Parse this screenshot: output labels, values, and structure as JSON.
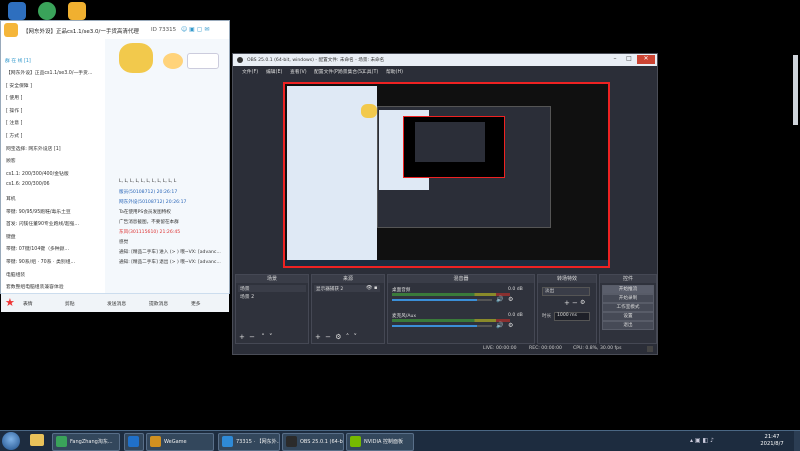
{
  "chat": {
    "title": "【网东外设】正品cs1.1/se3.0/一手货高清代理",
    "id": "ID 73315",
    "side_tab": "群 在 线 [1]",
    "side_rows": [
      "【网东外设】正品cs1.1/se3.0/一手货...",
      "[ 安全保障 ]",
      "[ 使用 ]",
      "[ 操作 ]",
      "[ 注意 ]",
      "[ 方式 ]",
      "网宝选择: 网东外设店 [1]",
      "顾客",
      "cs1.1: 200/300/400/金钻版",
      "cs1.6: 200/300/06",
      "耳机",
      "带键: 90/95/95跑鞋/毒乐土豆",
      "首发: 闪镁任董90专业跑线/超强...",
      "键盘",
      "带键: 07键/104键（多种颜...",
      "带键: 90系/组 · 70系 · 类别组...",
      "电脑组装",
      "套数整组电脑组装兼容体验"
    ],
    "messages": [
      "L, L, L, L, L, L, L, L, L, L, L",
      "版员(50108712) 20:26:17",
      "网东外设(50108712) 20:26:17",
      "Ta在使用PS会员发图特权",
      "广告消息截图，不要留在本群",
      "东风(301115610) 21:26:45",
      "感觉",
      "通知: [精品二手车] 进入 (> ) 哦~VX: [advanc...",
      "通知: [精品二手车] 退出 (> ) 哦~VX: [advanc..."
    ],
    "toolbar": [
      "表情",
      "剪贴",
      "发送消息",
      "提款消息",
      "更多"
    ]
  },
  "obs": {
    "title": "OBS 25.0.1 (64-bit, windows) - 配置文件: 未命名 - 场景: 未命名",
    "menu": [
      "文件(F)",
      "编辑(E)",
      "查看(V)",
      "配置文件(P)",
      "场景集合(S)",
      "工具(T)",
      "帮助(H)"
    ],
    "docks": {
      "scenes": {
        "header": "场景",
        "items": [
          "场景",
          "场景 2"
        ]
      },
      "sources": {
        "header": "来源",
        "items": [
          "显示器捕获 2"
        ]
      },
      "mixer": {
        "header": "混音器",
        "channels": [
          {
            "name": "桌面音频",
            "level": "0.0 dB",
            "volume": 0.85
          },
          {
            "name": "麦克风/Aux",
            "level": "0.0 dB",
            "volume": 0.85
          }
        ]
      },
      "transitions": {
        "header": "转场特效",
        "type": "淡出",
        "duration_label": "时长",
        "duration": "1000 ms"
      },
      "controls": {
        "header": "控件",
        "buttons": [
          "开始推流",
          "开始录制",
          "工作室模式",
          "设置",
          "退出"
        ]
      }
    },
    "status": {
      "live": "LIVE: 00:00:00",
      "rec": "REC: 00:00:00",
      "cpu": "CPU: 0.8%, 30.00 fps"
    }
  },
  "taskbar": {
    "items": [
      {
        "label": "FangZhang淘东...",
        "color": "#3aa35a"
      },
      {
        "label": "",
        "color": "#2070c8"
      },
      {
        "label": "WeGame",
        "color": "#d09020"
      },
      {
        "label": "73315 · 【网东外...",
        "color": "#2f8ad6"
      },
      {
        "label": "OBS 25.0.1 (64-b...",
        "color": "#2b2b2b"
      },
      {
        "label": "NVIDIA 控制面板",
        "color": "#76b900"
      }
    ],
    "time": "21:47",
    "date": "2021/8/7"
  },
  "colors": {
    "obs_bg": "#2b2e38",
    "preview_border": "#e22222",
    "taskbar": "#1d2c3f"
  }
}
